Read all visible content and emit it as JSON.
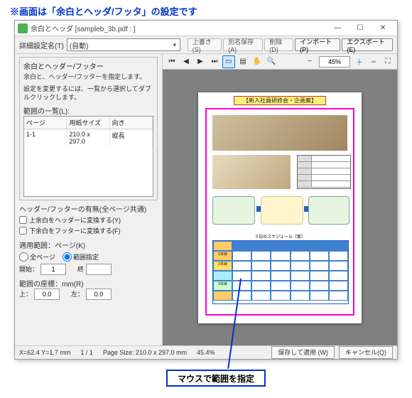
{
  "caption": "※画面は「余白とヘッダ/フッタ」の設定です",
  "window": {
    "title": "余白とヘッダ [sampleb_3b.pdf : ]",
    "detail_name_label": "詳細設定名(T)",
    "preset_value": "(自動)",
    "buttons": {
      "overwrite": "上書き(S)",
      "save_as": "別名保存(A)",
      "delete": "削除(D)",
      "import": "インポート(P)",
      "export": "エクスポート(E)"
    }
  },
  "panel": {
    "group_title": "余白とヘッダー/フッター",
    "desc1": "余白と、ヘッダー/フッターを指定します。",
    "desc2": "設定を変更するには、一覧から選択してダブルクリックします。",
    "list_label": "範囲の一覧(L):",
    "cols": {
      "page": "ページ",
      "size": "用紙サイズ",
      "orient": "向き"
    },
    "rows": [
      {
        "page": "1-1",
        "size": "210.0 x 297.0",
        "orient": "縦長"
      }
    ],
    "hf_section": "ヘッダー/フッターの有無(全ページ共通)",
    "chk_header": "上余白をヘッダーに変換する(Y)",
    "chk_footer": "下余白をフッターに変換する(F)",
    "range_section": "適用範囲：ページ(K)",
    "radio_all": "全ページ",
    "radio_range": "範囲指定",
    "start_label": "開始：",
    "end_label": "終",
    "start_val": "1",
    "end_val": "",
    "margin_section": "範囲の座標：mm(R)",
    "top_label": "上：",
    "left_label": "左：",
    "top_val": "0.0",
    "left_val": "0.0"
  },
  "preview": {
    "zoom": "45%",
    "doc_title": "【新入社員研修会・企画案】",
    "sched_title": "３日のスケジュール（案）"
  },
  "status": {
    "coord": "X=62.4 Y=1.7 mm",
    "pages": "1 / 1",
    "pagesize": "Page Size: 210.0 x 297.0 mm",
    "zoom": "45.4%"
  },
  "dialog_buttons": {
    "apply": "保存して適用 (W)",
    "cancel": "キャンセル(Q)"
  },
  "callout": "マウスで範囲を指定"
}
